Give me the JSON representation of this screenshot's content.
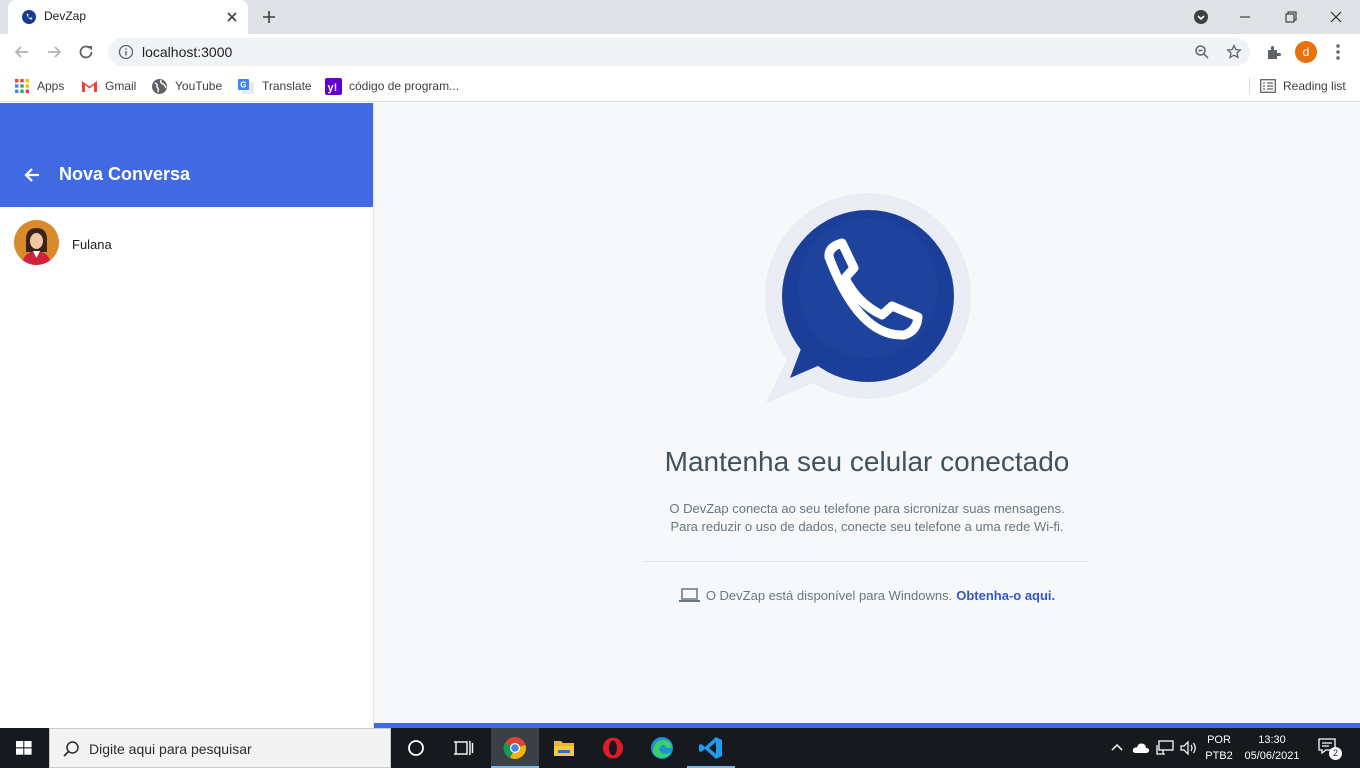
{
  "browser": {
    "tab_title": "DevZap",
    "url": "localhost:3000",
    "profile_initial": "d",
    "bookmarks": [
      {
        "label": "Apps",
        "icon": "apps-grid-icon"
      },
      {
        "label": "Gmail",
        "icon": "gmail-icon"
      },
      {
        "label": "YouTube",
        "icon": "globe-icon"
      },
      {
        "label": "Translate",
        "icon": "translate-icon"
      },
      {
        "label": "código de program...",
        "icon": "yahoo-icon"
      }
    ],
    "reading_list": "Reading list"
  },
  "app": {
    "left": {
      "title": "Nova Conversa",
      "contacts": [
        {
          "name": "Fulana"
        }
      ]
    },
    "right": {
      "headline": "Mantenha seu celular conectado",
      "desc_line1": "O DevZap conecta ao seu telefone para sicronizar suas mensagens.",
      "desc_line2": "Para reduzir o uso de dados, conecte seu telefone a uma rede Wi-fi.",
      "windows_text": "O DevZap está disponível para Windowns.",
      "windows_link": "Obtenha-o aqui."
    },
    "colors": {
      "accent": "#4169e1",
      "link": "#3357c6"
    }
  },
  "taskbar": {
    "search_placeholder": "Digite aqui para pesquisar",
    "lang_top": "POR",
    "lang_bottom": "PTB2",
    "time": "13:30",
    "date": "05/06/2021",
    "notification_count": "2"
  }
}
